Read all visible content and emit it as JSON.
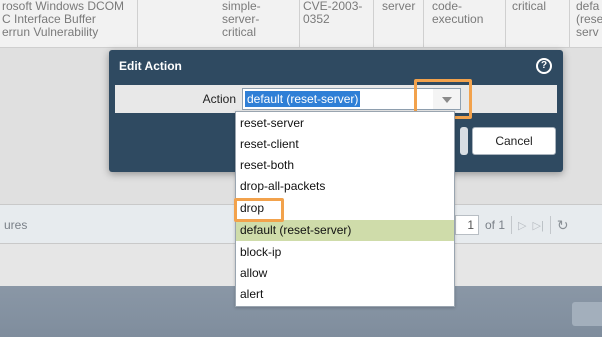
{
  "background_table": {
    "cells": [
      "rosoft Windows DCOM\nC Interface Buffer\nerrun Vulnerability",
      "simple-\nserver-\ncritical",
      "CVE-2003-\n0352",
      "server",
      "code-\nexecution",
      "critical",
      "defa\n(rese\nserv"
    ]
  },
  "footer": {
    "label": "ures",
    "page_value": "1",
    "page_of": "of 1"
  },
  "dialog": {
    "title": "Edit Action",
    "action_label": "Action",
    "selected_value": "default (reset-server)",
    "cancel_label": "Cancel"
  },
  "dropdown": {
    "options": [
      "reset-server",
      "reset-client",
      "reset-both",
      "drop-all-packets",
      "drop",
      "default (reset-server)",
      "block-ip",
      "allow",
      "alert"
    ],
    "selected_index": 5,
    "highlighted_option": "drop"
  },
  "colors": {
    "dialog_bg": "#2f4a61",
    "highlight_orange": "#f2a24c",
    "selected_option_bg": "#cfdcaa",
    "selection_blue": "#2f7fd6"
  },
  "icons": {
    "help": "help-icon",
    "dropdown_arrow": "chevron-down-icon",
    "refresh": "refresh-icon"
  }
}
